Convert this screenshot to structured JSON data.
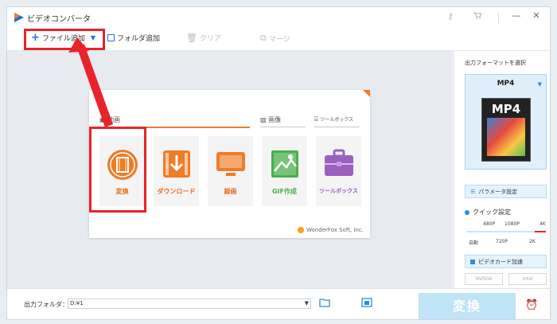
{
  "window": {
    "title": "ビデオコンバータ"
  },
  "titlebar_icons": [
    "key-icon",
    "cart-icon",
    "minimize-icon",
    "close-icon"
  ],
  "titlebar_glyphs": {
    "minimize": "—",
    "close": "✕"
  },
  "toolbar": {
    "add_file": "ファイル追加",
    "add_folder": "フォルダ追加",
    "clear": "クリア",
    "merge": "マージ"
  },
  "home": {
    "categories": {
      "video": "動画",
      "image": "画像",
      "toolbox": "ツールボックス"
    },
    "tiles": [
      {
        "label": "変換",
        "icon": "film-icon",
        "color": "#f07c26"
      },
      {
        "label": "ダウンロード",
        "icon": "download-icon",
        "color": "#f07c26"
      },
      {
        "label": "録画",
        "icon": "monitor-icon",
        "color": "#f07c26"
      },
      {
        "label": "GIF作成",
        "icon": "image-icon",
        "color": "#48b04a"
      },
      {
        "label": "ツールボックス",
        "icon": "toolbox-icon",
        "color": "#9b5fc0"
      }
    ],
    "copyright": "WonderFox Soft, Inc."
  },
  "right_panel": {
    "output_format_label": "出力フォーマットを選択",
    "selected_format": "MP4",
    "thumb_text": "MP4",
    "param_button": "パラメータ設定",
    "quick_label": "クイック設定",
    "quality_top": [
      "480P",
      "1080P",
      "4K"
    ],
    "quality_bottom": [
      "自動",
      "720P",
      "2K"
    ],
    "gpu_button": "ビデオカード加速",
    "vendors": [
      "NVIDIA",
      "Intel"
    ]
  },
  "bottom": {
    "output_folder_label": "出力フォルダ：",
    "output_folder_value": "D:¥1",
    "convert_button": "変換"
  },
  "colors": {
    "accent": "#1f6fd1",
    "highlight": "#e8232a",
    "orange": "#f07c26",
    "convert_disabled": "#bfe3f7"
  }
}
